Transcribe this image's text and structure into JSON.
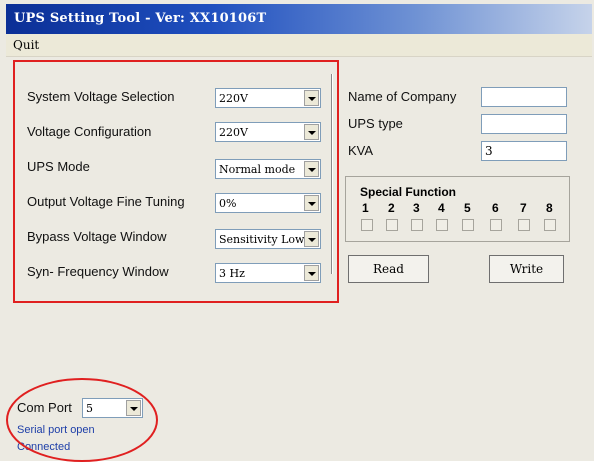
{
  "window": {
    "title": "UPS Setting Tool - Ver: XX10106T"
  },
  "menu": {
    "quit": "Quit"
  },
  "settings": {
    "system_voltage": {
      "label": "System Voltage Selection",
      "value": "220V"
    },
    "voltage_config": {
      "label": "Voltage Configuration",
      "value": "220V"
    },
    "ups_mode": {
      "label": "UPS Mode",
      "value": "Normal mode"
    },
    "output_fine_tuning": {
      "label": "Output Voltage Fine Tuning",
      "value": "0%"
    },
    "bypass_window": {
      "label": "Bypass Voltage Window",
      "value": "Sensitivity Low"
    },
    "syn_frequency": {
      "label": "Syn- Frequency Window",
      "value": "3 Hz"
    }
  },
  "info": {
    "company": {
      "label": "Name of Company",
      "value": ""
    },
    "ups_type": {
      "label": "UPS type",
      "value": ""
    },
    "kva": {
      "label": "KVA",
      "value": "3"
    }
  },
  "special_function": {
    "title": "Special Function",
    "numbers": [
      "1",
      "2",
      "3",
      "4",
      "5",
      "6",
      "7",
      "8"
    ],
    "checked": [
      false,
      false,
      false,
      false,
      false,
      false,
      false,
      false
    ]
  },
  "buttons": {
    "read": "Read",
    "write": "Write"
  },
  "com": {
    "label": "Com Port",
    "value": "5",
    "status_line1": "Serial port open",
    "status_line2": "Connected"
  },
  "colors": {
    "annotation": "#e02020",
    "title_bar": "#0b2f96",
    "status_text": "#1e3fa8"
  }
}
